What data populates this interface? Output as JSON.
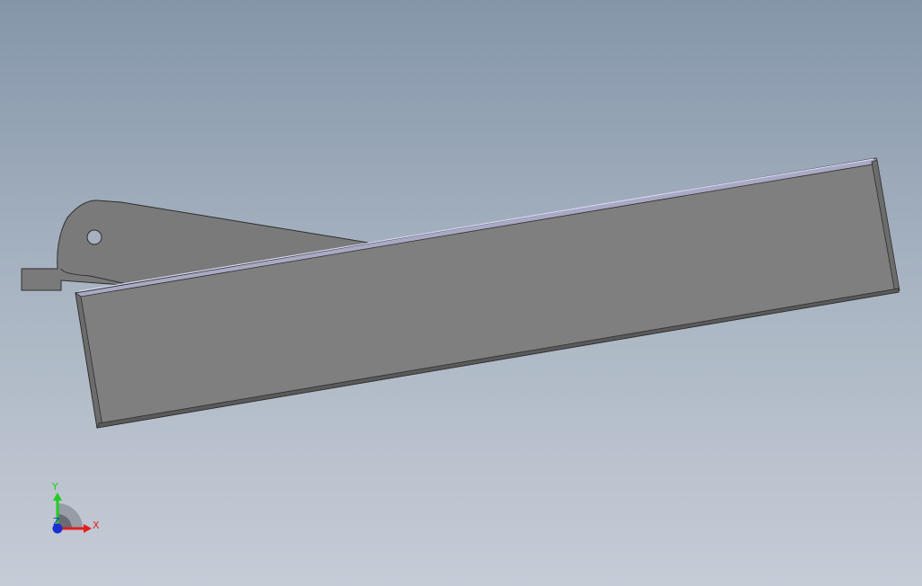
{
  "triad": {
    "x_label": "X",
    "y_label": "Y",
    "z_label": "Z",
    "x_color": "#e02020",
    "y_color": "#22cc22",
    "z_color": "#1a2fd0"
  },
  "model": {
    "face_color": "#7f7f7f",
    "edge_color": "#2e2e2e",
    "highlight_color": "#c8c8ee",
    "bracket_color": "#7a7a7a"
  }
}
